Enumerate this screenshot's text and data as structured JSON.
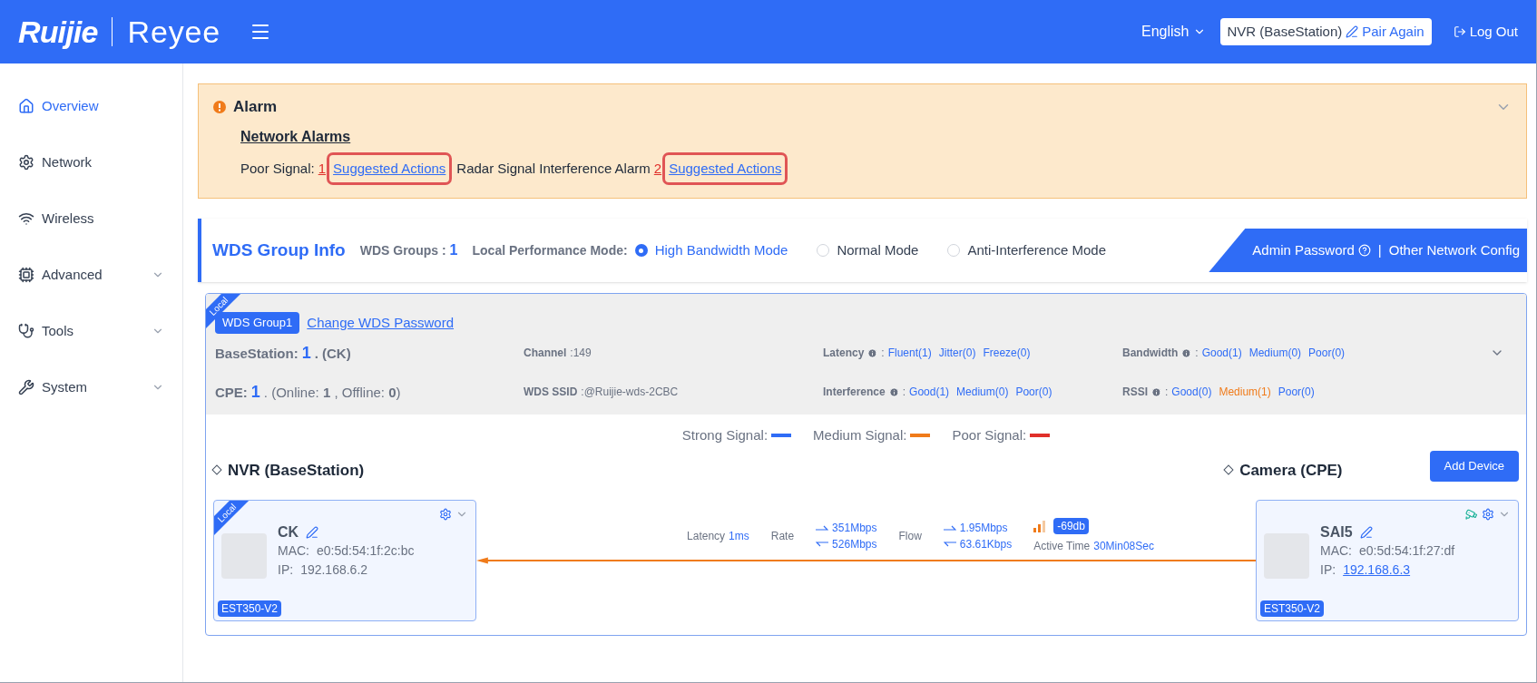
{
  "header": {
    "brand": "Ruijie",
    "product": "Reyee",
    "language": "English",
    "device": "NVR (BaseStation)",
    "pair_again": "Pair Again",
    "logout": "Log Out"
  },
  "sidebar": {
    "items": [
      {
        "label": "Overview",
        "selected": true,
        "expandable": false
      },
      {
        "label": "Network",
        "selected": false,
        "expandable": false
      },
      {
        "label": "Wireless",
        "selected": false,
        "expandable": false
      },
      {
        "label": "Advanced",
        "selected": false,
        "expandable": true
      },
      {
        "label": "Tools",
        "selected": false,
        "expandable": true
      },
      {
        "label": "System",
        "selected": false,
        "expandable": true
      }
    ]
  },
  "alarm": {
    "title": "Alarm",
    "expanded": true,
    "section": "Network Alarms",
    "items": [
      {
        "label": "Poor Signal:",
        "count": "1",
        "action": "Suggested Actions",
        "highlighted": true
      },
      {
        "label": "Radar Signal Interference Alarm",
        "count": "2",
        "action": "Suggested Actions",
        "highlighted": true
      }
    ]
  },
  "wds_info": {
    "title": "WDS Group Info",
    "groups_label": "WDS Groups :",
    "groups_value": "1",
    "mode_label": "Local Performance Mode:",
    "modes": [
      {
        "label": "High Bandwidth Mode",
        "selected": true
      },
      {
        "label": "Normal Mode",
        "selected": false
      },
      {
        "label": "Anti-Interference Mode",
        "selected": false
      }
    ],
    "admin_password": "Admin Password",
    "separator": "|",
    "other_config": "Other Network Config"
  },
  "group": {
    "ribbon": "Local",
    "name": "WDS Group1",
    "change_password": "Change WDS Password",
    "basestation": {
      "label": "BaseStation:",
      "count": "1",
      "rest": ". (CK)"
    },
    "cpe": {
      "label": "CPE:",
      "count": "1",
      "rest": ". (Online: **1** , Offline: **0**)"
    },
    "channel": {
      "label": "Channel",
      "value": ":149"
    },
    "ssid": {
      "label": "WDS SSID",
      "value": ":@Ruijie-wds-2CBC"
    },
    "metrics": [
      {
        "label": "Latency",
        "colon": ":",
        "values": [
          {
            "text": "Fluent(1)",
            "color": "#2f6cf6"
          },
          {
            "text": "Jitter(0)",
            "color": "#2f6cf6"
          },
          {
            "text": "Freeze(0)",
            "color": "#2f6cf6"
          }
        ]
      },
      {
        "label": "Bandwidth",
        "colon": ":",
        "values": [
          {
            "text": "Good(1)",
            "color": "#2f6cf6"
          },
          {
            "text": "Medium(0)",
            "color": "#2f6cf6"
          },
          {
            "text": "Poor(0)",
            "color": "#2f6cf6"
          }
        ]
      },
      {
        "label": "Interference",
        "colon": ":",
        "values": [
          {
            "text": "Good(1)",
            "color": "#2f6cf6"
          },
          {
            "text": "Medium(0)",
            "color": "#2f6cf6"
          },
          {
            "text": "Poor(0)",
            "color": "#2f6cf6"
          }
        ]
      },
      {
        "label": "RSSI",
        "colon": ":",
        "values": [
          {
            "text": "Good(0)",
            "color": "#2f6cf6"
          },
          {
            "text": "Medium(1)",
            "color": "#f07b1a"
          },
          {
            "text": "Poor(0)",
            "color": "#2f6cf6"
          }
        ]
      }
    ],
    "legend": [
      {
        "label": "Strong Signal:",
        "color": "#2f6cf6"
      },
      {
        "label": "Medium Signal:",
        "color": "#f07b1a"
      },
      {
        "label": "Poor Signal:",
        "color": "#e0302a"
      }
    ],
    "base_title": "NVR (BaseStation)",
    "cpe_title": "Camera (CPE)",
    "add_device": "Add Device",
    "devices": [
      {
        "ribbon": "Local",
        "name": "CK",
        "mac_label": "MAC:",
        "mac": "e0:5d:54:1f:2c:bc",
        "ip_label": "IP:",
        "ip": "192.168.6.2",
        "ip_link": false,
        "model": "EST350-V2",
        "camera": false
      },
      {
        "name": "SAI5",
        "mac_label": "MAC:",
        "mac": "e0:5d:54:1f:27:df",
        "ip_label": "IP:",
        "ip": "192.168.6.3",
        "ip_link": true,
        "model": "EST350-V2",
        "camera": true
      }
    ],
    "link": {
      "latency_label": "Latency",
      "latency": "1ms",
      "rate_label": "Rate",
      "rate_up": "351Mbps",
      "rate_down": "526Mbps",
      "flow_label": "Flow",
      "flow_up": "1.95Mbps",
      "flow_down": "63.61Kbps",
      "rssi": "-69db",
      "active_label": "Active Time",
      "active": "30Min08Sec",
      "color": "#f07b1a"
    }
  }
}
